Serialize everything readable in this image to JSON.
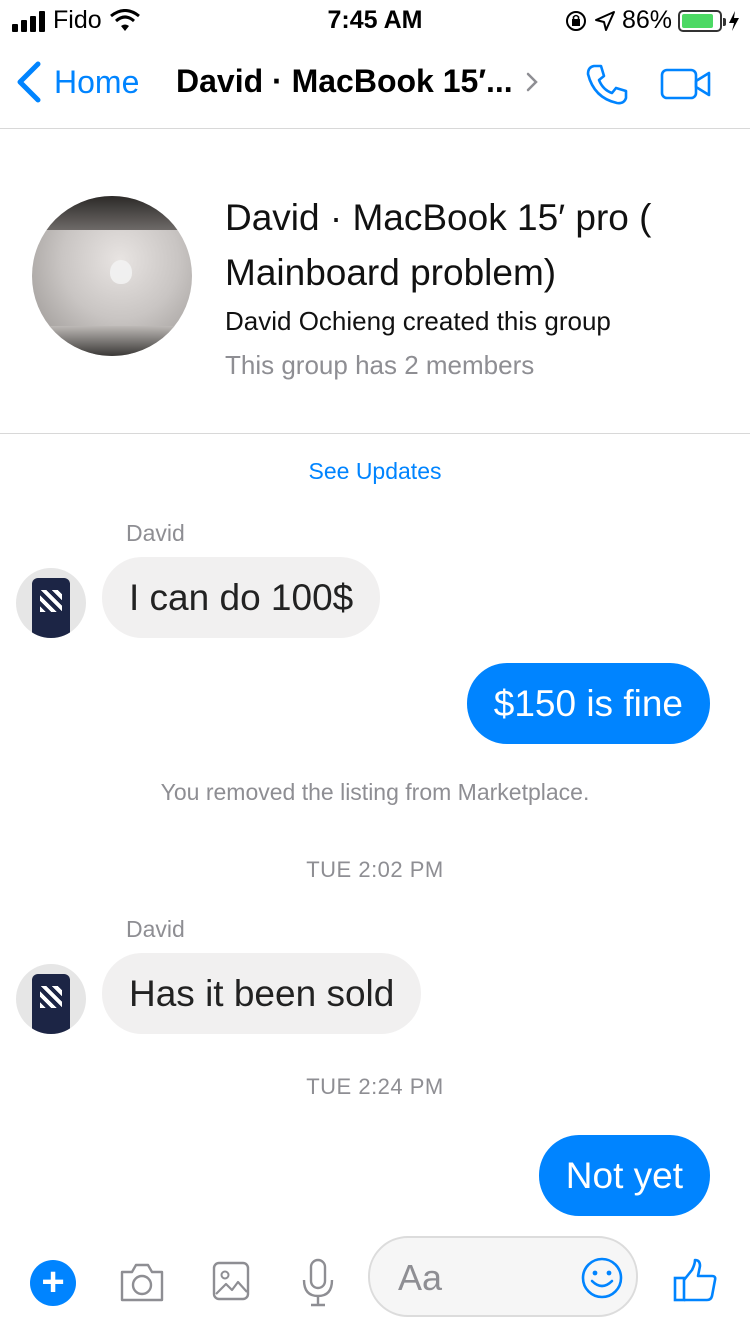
{
  "status_bar": {
    "carrier": "Fido",
    "time": "7:45 AM",
    "battery_percent": "86%",
    "battery_level": 0.86,
    "battery_color": "#4cd964"
  },
  "nav": {
    "back_label": "Home",
    "title": "David · MacBook 15′...",
    "icons": [
      "chevron-left-icon",
      "chevron-right-icon",
      "phone-icon",
      "video-camera-icon"
    ],
    "accent_color": "#0084ff"
  },
  "group": {
    "title": "David · MacBook 15′ pro ( Mainboard problem)",
    "creator_text": "David Ochieng created this group",
    "members_text": "This group has 2 members"
  },
  "see_updates": "See Updates",
  "messages": [
    {
      "type": "incoming",
      "sender": "David",
      "text": "I can do 100$"
    },
    {
      "type": "outgoing",
      "text": "$150 is fine"
    },
    {
      "type": "system",
      "text": "You removed the listing from Marketplace."
    },
    {
      "type": "timestamp",
      "text": "TUE 2:02 PM"
    },
    {
      "type": "incoming",
      "sender": "David",
      "text": "Has it been sold"
    },
    {
      "type": "timestamp",
      "text": "TUE 2:24 PM"
    },
    {
      "type": "outgoing",
      "text": "Not yet"
    }
  ],
  "composer": {
    "placeholder": "Aa",
    "plus_label": "+",
    "icons": [
      "plus-icon",
      "camera-icon",
      "image-icon",
      "microphone-icon",
      "emoji-icon",
      "thumbs-up-icon"
    ]
  },
  "colors": {
    "incoming_bubble": "#f1f0f0",
    "outgoing_bubble": "#0084ff",
    "muted_text": "#8e8e93"
  }
}
